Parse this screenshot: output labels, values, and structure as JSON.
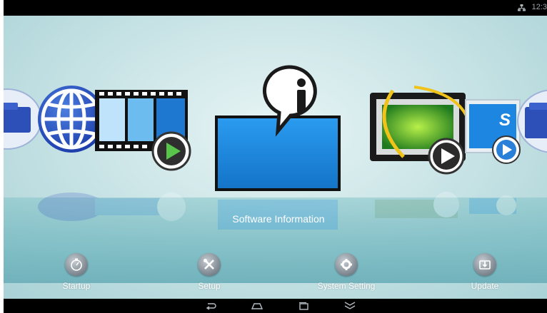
{
  "status_bar": {
    "clock": "12:3",
    "network_icon": "ethernet-icon"
  },
  "carousel": {
    "items": [
      {
        "name": "folder-app",
        "icon": "folder-icon"
      },
      {
        "name": "browser-app",
        "icon": "globe-icon"
      },
      {
        "name": "video-player-app",
        "icon": "film-play-icon"
      },
      {
        "name": "software-information-app",
        "icon": "info-screen-icon",
        "selected": true
      },
      {
        "name": "media-player-app",
        "icon": "photo-play-icon"
      },
      {
        "name": "slideshow-app",
        "icon": "s-play-icon"
      },
      {
        "name": "folder-app-right",
        "icon": "folder-icon"
      }
    ],
    "selected_label": "Software Information"
  },
  "dock": {
    "items": [
      {
        "label": "Startup",
        "icon": "timer-icon"
      },
      {
        "label": "Setup",
        "icon": "tools-icon"
      },
      {
        "label": "System Setting",
        "icon": "gear-icon"
      },
      {
        "label": "Update",
        "icon": "download-icon"
      }
    ]
  },
  "nav_bar": {
    "buttons": [
      "back-icon",
      "home-icon",
      "recent-apps-icon",
      "hide-icon"
    ]
  },
  "colors": {
    "screen_blue": "#1a8fe6",
    "play_green": "#3cb84a",
    "dock_icon_gray": "#8a939b"
  }
}
